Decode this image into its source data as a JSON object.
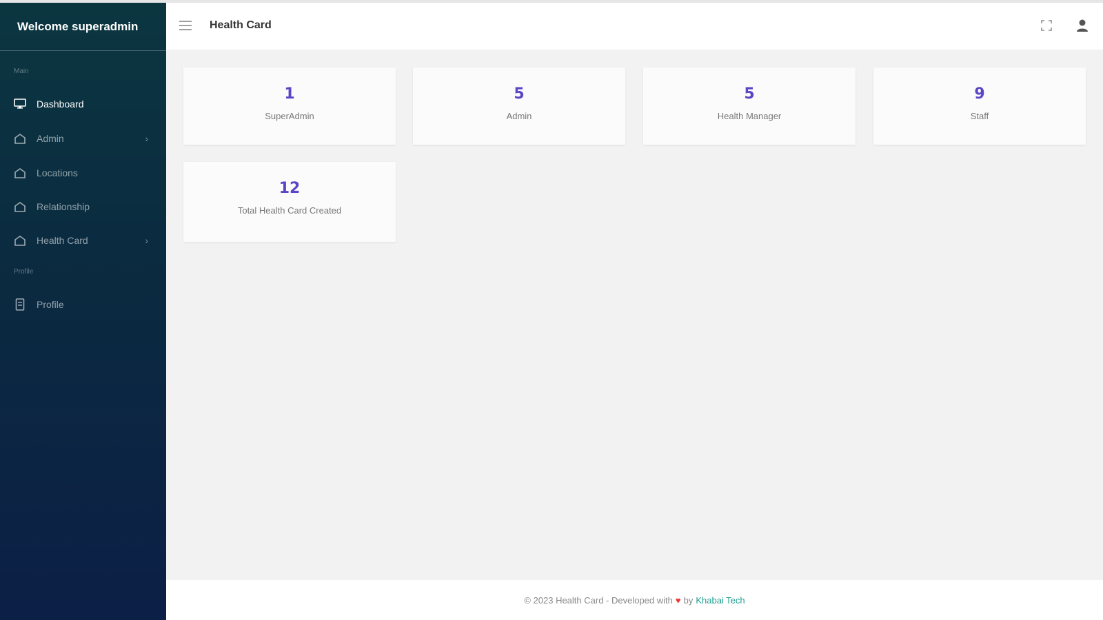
{
  "sidebar": {
    "brand": "Welcome superadmin",
    "sections": {
      "main": "Main",
      "profile": "Profile"
    },
    "items": [
      {
        "label": "Dashboard",
        "icon": "monitor-icon"
      },
      {
        "label": "Admin",
        "icon": "home-icon",
        "chevron": "›"
      },
      {
        "label": "Locations",
        "icon": "home-icon"
      },
      {
        "label": "Relationship",
        "icon": "home-icon"
      },
      {
        "label": "Health Card",
        "icon": "home-icon",
        "chevron": "›"
      },
      {
        "label": "Profile",
        "icon": "document-icon"
      }
    ]
  },
  "header": {
    "title": "Health Card"
  },
  "stats": [
    {
      "value": "1",
      "label": "SuperAdmin"
    },
    {
      "value": "5",
      "label": "Admin"
    },
    {
      "value": "5",
      "label": "Health Manager"
    },
    {
      "value": "9",
      "label": "Staff"
    },
    {
      "value": "12",
      "label": "Total Health Card Created"
    }
  ],
  "footer": {
    "prefix": "© 2023 Health Card - Developed with",
    "heart": "♥",
    "by": "by",
    "company": "Khabai Tech"
  },
  "colors": {
    "accent": "#5b45c6",
    "sidebar_top": "#0b3640",
    "sidebar_bottom": "#0c1f47",
    "link": "#1e9e8f",
    "heart": "#e53935"
  }
}
